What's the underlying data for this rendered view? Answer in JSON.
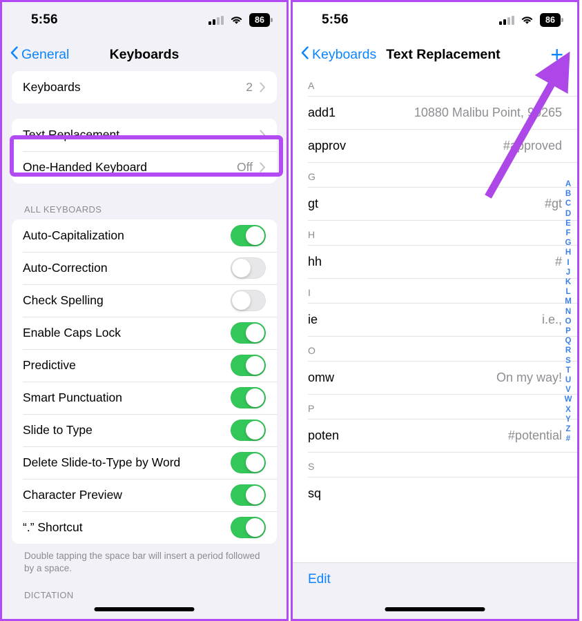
{
  "accent": {
    "purple_annotation": "#b24bf3",
    "ios_blue": "#0a84ff",
    "toggle_green": "#34c759",
    "index_blue": "#3d7fe8",
    "secondary_text": "#8e8e93"
  },
  "left_panel": {
    "status_bar": {
      "time": "5:56",
      "battery_percent": "86",
      "signal_icon": "cellular-signal-icon",
      "wifi_icon": "wifi-icon",
      "battery_icon": "battery-icon"
    },
    "nav": {
      "back_label": "General",
      "back_icon": "chevron-left-icon",
      "title": "Keyboards"
    },
    "group_one": [
      {
        "label": "Keyboards",
        "value": "2",
        "has_chevron": true
      }
    ],
    "group_two": [
      {
        "label": "Text Replacement",
        "value": "",
        "has_chevron": true,
        "highlighted": true
      },
      {
        "label": "One-Handed Keyboard",
        "value": "Off",
        "has_chevron": true,
        "highlighted": false
      }
    ],
    "all_keyboards_header": "ALL KEYBOARDS",
    "toggles": [
      {
        "label": "Auto-Capitalization",
        "on": true
      },
      {
        "label": "Auto-Correction",
        "on": false
      },
      {
        "label": "Check Spelling",
        "on": false
      },
      {
        "label": "Enable Caps Lock",
        "on": true
      },
      {
        "label": "Predictive",
        "on": true
      },
      {
        "label": "Smart Punctuation",
        "on": true
      },
      {
        "label": "Slide to Type",
        "on": true
      },
      {
        "label": "Delete Slide-to-Type by Word",
        "on": true
      },
      {
        "label": "Character Preview",
        "on": true
      },
      {
        "label": "“.” Shortcut",
        "on": true
      }
    ],
    "footnote": "Double tapping the space bar will insert a period followed by a space.",
    "dictation_header": "DICTATION"
  },
  "right_panel": {
    "status_bar": {
      "time": "5:56",
      "battery_percent": "86",
      "signal_icon": "cellular-signal-icon",
      "wifi_icon": "wifi-icon",
      "battery_icon": "battery-icon"
    },
    "nav": {
      "back_label": "Keyboards",
      "back_icon": "chevron-left-icon",
      "title": "Text Replacement",
      "add_icon": "plus-icon",
      "add_label": "+"
    },
    "sections": [
      {
        "letter": "A",
        "entries": [
          {
            "shortcut": "add1",
            "phrase": "10880 Malibu Point, 90265"
          },
          {
            "shortcut": "approv",
            "phrase": "#approved"
          }
        ]
      },
      {
        "letter": "G",
        "entries": [
          {
            "shortcut": "gt",
            "phrase": "#gt"
          }
        ]
      },
      {
        "letter": "H",
        "entries": [
          {
            "shortcut": "hh",
            "phrase": "#"
          }
        ]
      },
      {
        "letter": "I",
        "entries": [
          {
            "shortcut": "ie",
            "phrase": "i.e.,"
          }
        ]
      },
      {
        "letter": "O",
        "entries": [
          {
            "shortcut": "omw",
            "phrase": "On my way!"
          }
        ]
      },
      {
        "letter": "P",
        "entries": [
          {
            "shortcut": "poten",
            "phrase": "#potential"
          }
        ]
      },
      {
        "letter": "S",
        "entries": [
          {
            "shortcut": "sq",
            "phrase": "",
            "blurred": true
          }
        ]
      }
    ],
    "index": [
      "A",
      "B",
      "C",
      "D",
      "E",
      "F",
      "G",
      "H",
      "I",
      "J",
      "K",
      "L",
      "M",
      "N",
      "O",
      "P",
      "Q",
      "R",
      "S",
      "T",
      "U",
      "V",
      "W",
      "X",
      "Y",
      "Z",
      "#"
    ],
    "toolbar": {
      "edit_label": "Edit"
    }
  },
  "annotations": {
    "highlight_target": "Text Replacement",
    "arrow_target": "add-text-replacement-plus-button"
  }
}
